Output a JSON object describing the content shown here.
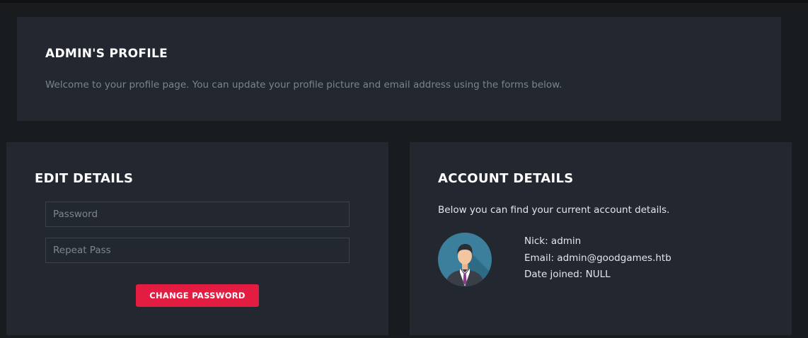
{
  "profile": {
    "title": "ADMIN'S PROFILE",
    "description": "Welcome to your profile page. You can update your profile picture and email address using the forms below."
  },
  "edit": {
    "title": "EDIT DETAILS",
    "password_placeholder": "Password",
    "repeat_placeholder": "Repeat Pass",
    "button_label": "CHANGE PASSWORD"
  },
  "account": {
    "title": "ACCOUNT DETAILS",
    "intro": "Below you can find your current account details.",
    "nick": "Nick: admin",
    "email": "Email: admin@goodgames.htb",
    "date_joined": "Date joined: NULL",
    "avatar_icon": "user-avatar-icon"
  },
  "colors": {
    "page_bg": "#181c1f",
    "panel_bg": "#232830",
    "accent": "#e31c41"
  }
}
